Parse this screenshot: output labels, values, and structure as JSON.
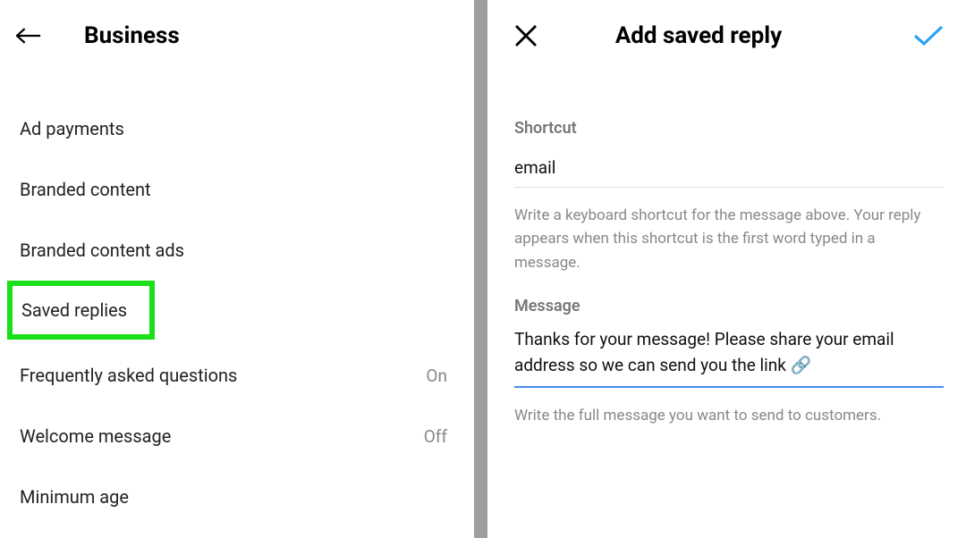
{
  "leftPanel": {
    "title": "Business",
    "items": [
      {
        "label": "Ad payments",
        "status": ""
      },
      {
        "label": "Branded content",
        "status": ""
      },
      {
        "label": "Branded content ads",
        "status": ""
      },
      {
        "label": "Saved replies",
        "status": "",
        "highlighted": true
      },
      {
        "label": "Frequently asked questions",
        "status": "On"
      },
      {
        "label": "Welcome message",
        "status": "Off"
      },
      {
        "label": "Minimum age",
        "status": ""
      }
    ]
  },
  "rightPanel": {
    "title": "Add saved reply",
    "shortcut": {
      "label": "Shortcut",
      "value": "email",
      "help": "Write a keyboard shortcut for the message above. Your reply appears when this shortcut is the first word typed in a message."
    },
    "message": {
      "label": "Message",
      "value": "Thanks for your message! Please share your email address so we can send you the link 🔗",
      "help": "Write the full message you want to send to customers."
    }
  }
}
